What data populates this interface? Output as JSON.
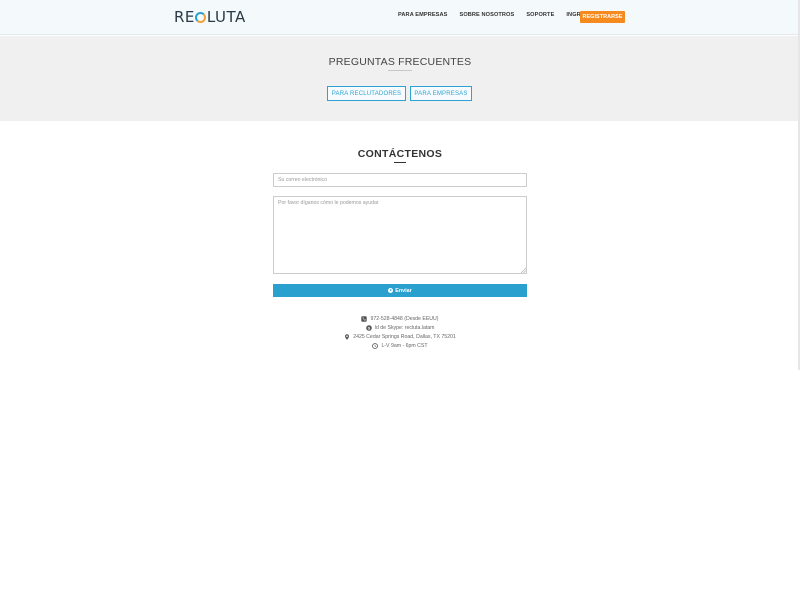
{
  "header": {
    "logo": {
      "pre": "RE",
      "post": "LUTA"
    },
    "nav": [
      "PARA EMPRESAS",
      "SOBRE NOSOTROS",
      "SOPORTE",
      "INGRESAR"
    ],
    "register_label": "REGISTRARSE",
    "register_color": "#f58a1f"
  },
  "faq": {
    "title": "PREGUNTAS FRECUENTES",
    "buttons": [
      "PARA RECLUTADORES",
      "PARA EMPRESAS"
    ],
    "accent": "#2ea3d2"
  },
  "contact": {
    "title": "CONTÁCTENOS",
    "email_placeholder": "Su correo electrónico",
    "message_placeholder": "Por favor díganos cómo le podemos ayudar",
    "send_label": "Enviar",
    "send_color": "#2aa0cf"
  },
  "info": {
    "phone": "972-528-4848 (Desde EEUU)",
    "skype": "Id de Skype: recluta.latam",
    "address": "2425 Cedar Springs Road, Dallas, TX 75201",
    "hours": "L-V 9am - 6pm CST"
  },
  "icons": {
    "phone": "phone-icon",
    "skype": "skype-icon",
    "address": "map-marker-icon",
    "hours": "clock-icon",
    "send": "play-circle-icon"
  }
}
